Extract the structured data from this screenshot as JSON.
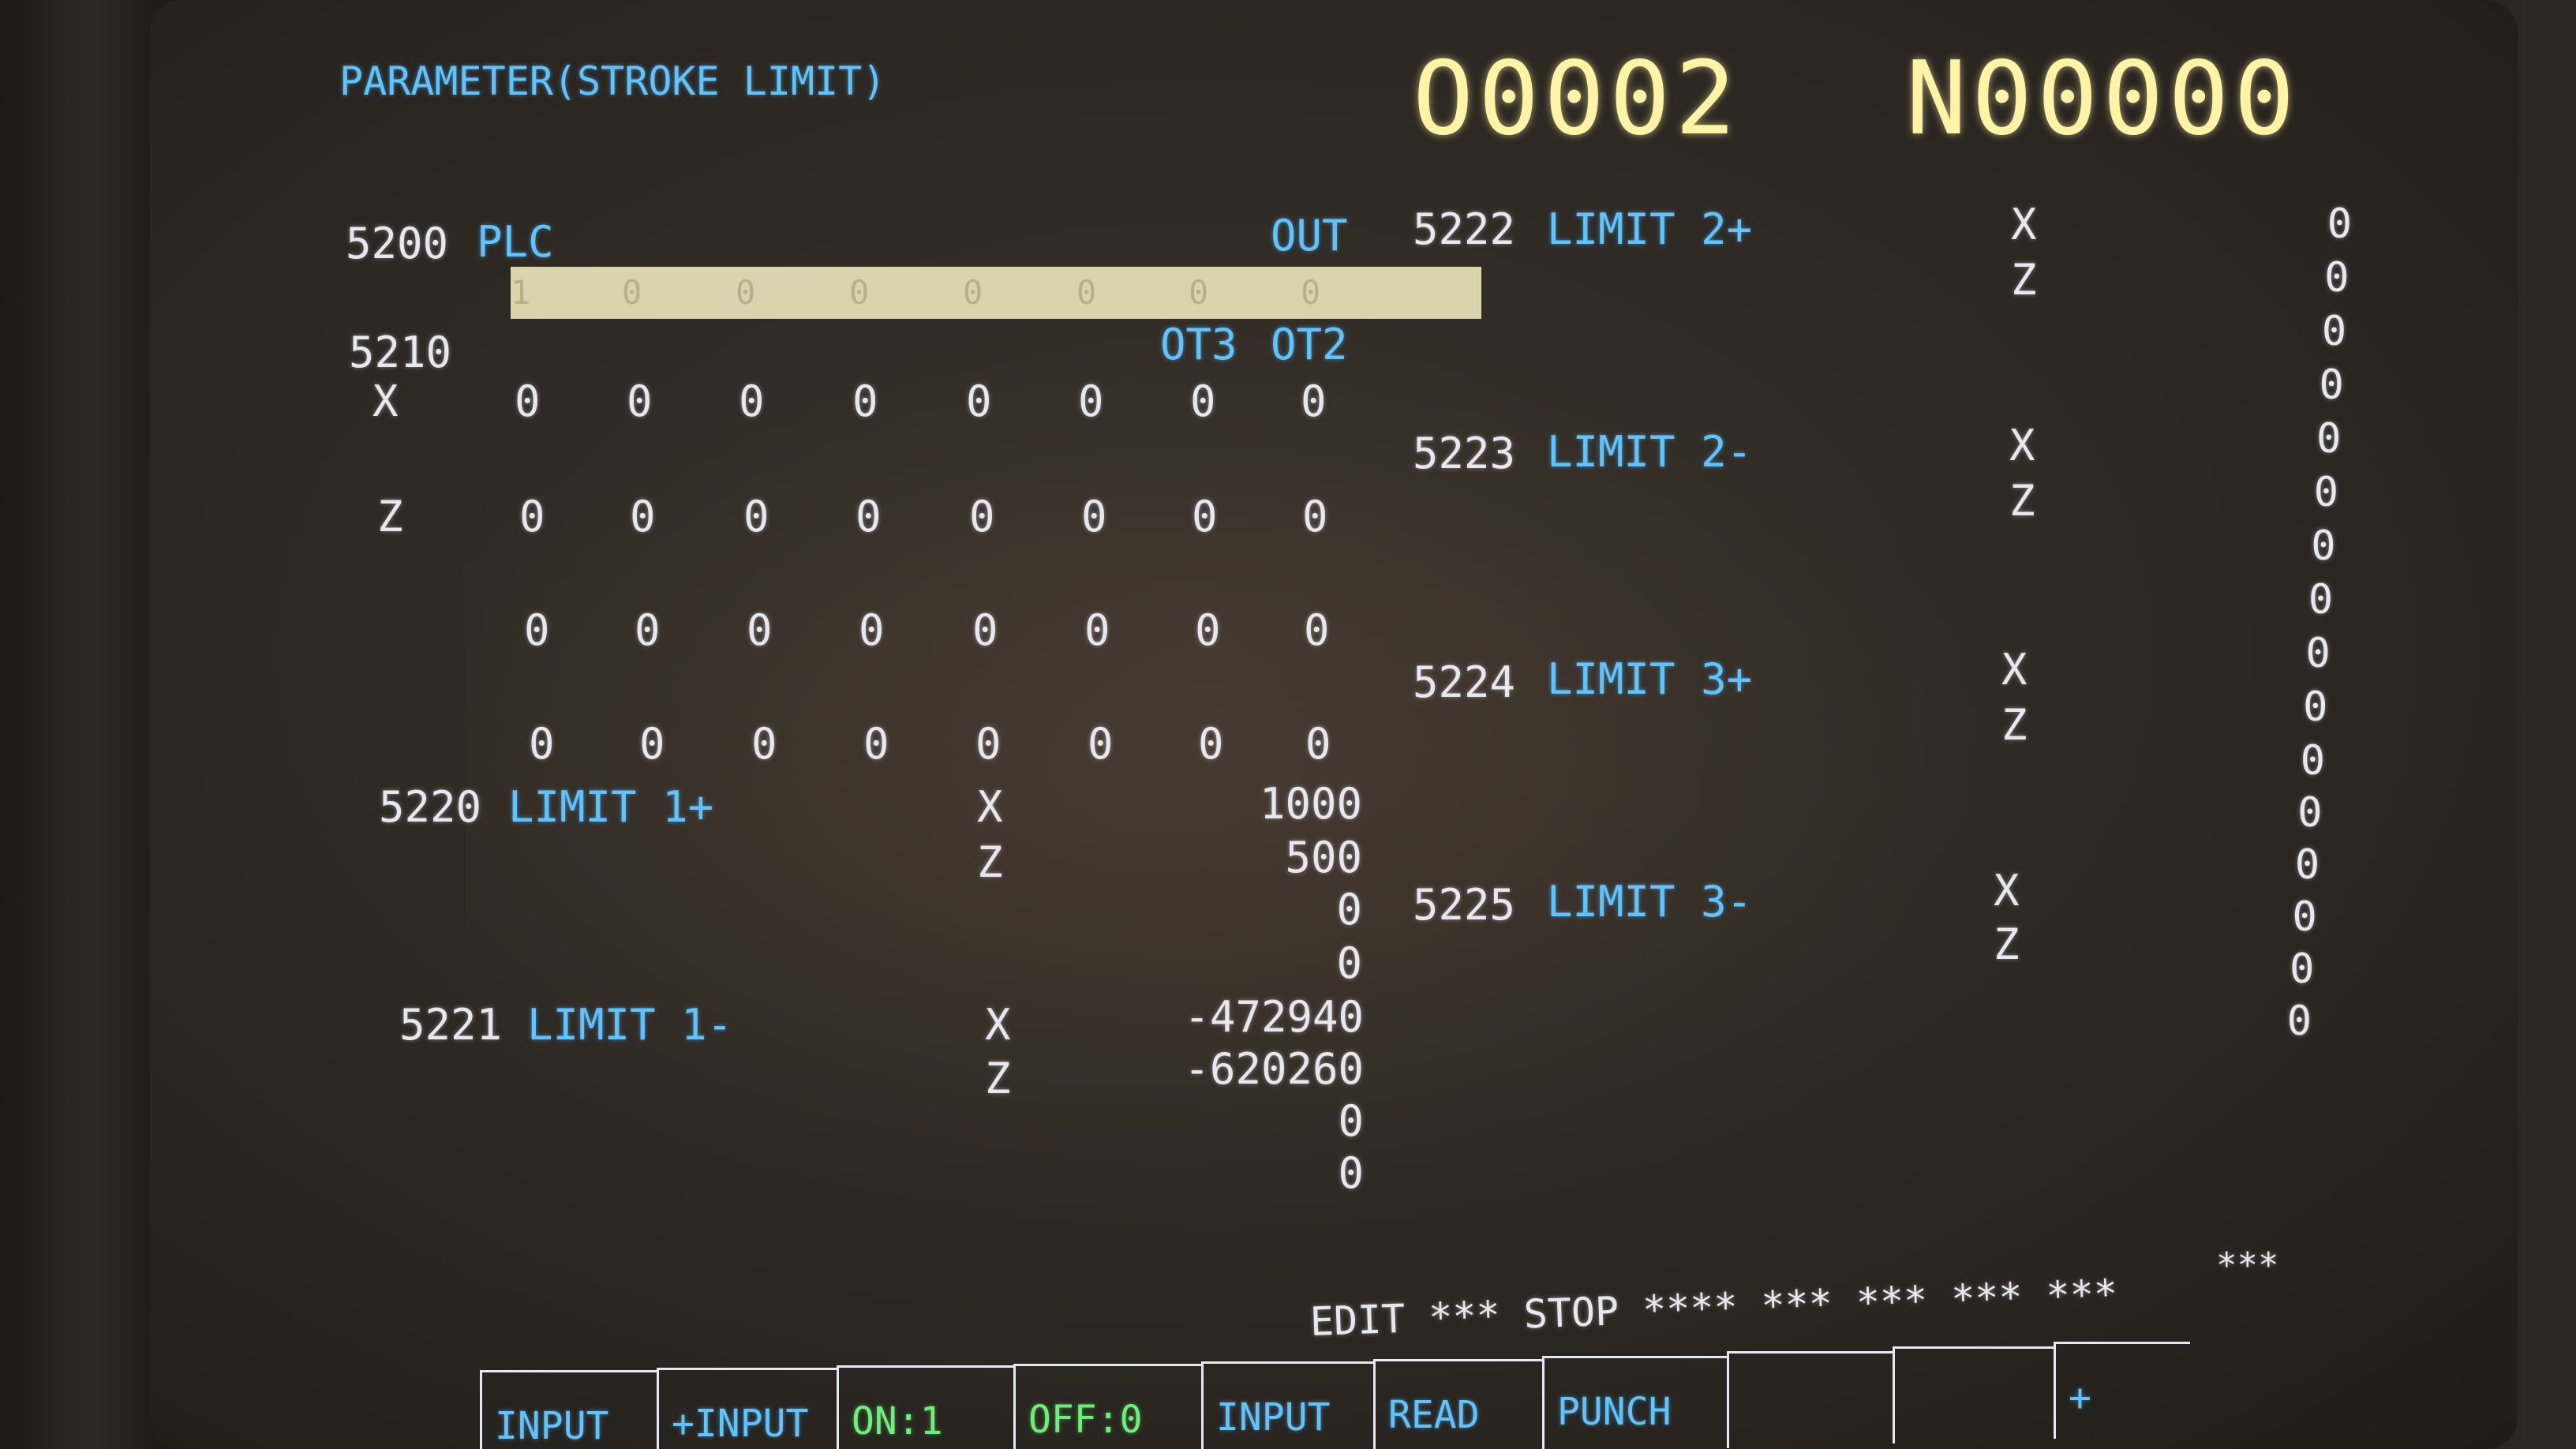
{
  "header": {
    "title": "PARAMETER(STROKE LIMIT)",
    "program_number": "O0002",
    "sequence_number": "N00000"
  },
  "plc": {
    "label": "5200 PLC",
    "out_label": "OUT",
    "bits": [
      "1",
      "0",
      "0",
      "0",
      "0",
      "0",
      "0",
      "0"
    ]
  },
  "p5210": {
    "label": "5210",
    "ot3_label": "OT3",
    "ot2_label": "OT2",
    "rows": [
      {
        "axis": "X",
        "bits": [
          "0",
          "0",
          "0",
          "0",
          "0",
          "0",
          "0",
          "0"
        ]
      },
      {
        "axis": "Z",
        "bits": [
          "0",
          "0",
          "0",
          "0",
          "0",
          "0",
          "0",
          "0"
        ]
      },
      {
        "axis": "",
        "bits": [
          "0",
          "0",
          "0",
          "0",
          "0",
          "0",
          "0",
          "0"
        ]
      },
      {
        "axis": "",
        "bits": [
          "0",
          "0",
          "0",
          "0",
          "0",
          "0",
          "0",
          "0"
        ]
      }
    ]
  },
  "limit_1_plus": {
    "number": "5220",
    "name": "LIMIT 1+",
    "axes": [
      "X",
      "Z"
    ],
    "values": [
      "1000",
      "500",
      "0",
      "0"
    ]
  },
  "limit_1_minus": {
    "number": "5221",
    "name": "LIMIT 1-",
    "axes": [
      "X",
      "Z"
    ],
    "values": [
      "-472940",
      "-620260",
      "0",
      "0"
    ]
  },
  "limit_2_plus": {
    "number": "5222",
    "name": "LIMIT 2+",
    "axes": [
      "X",
      "Z"
    ]
  },
  "limit_2_minus": {
    "number": "5223",
    "name": "LIMIT 2-",
    "axes": [
      "X",
      "Z"
    ]
  },
  "limit_3_plus": {
    "number": "5224",
    "name": "LIMIT 3+",
    "axes": [
      "X",
      "Z"
    ]
  },
  "limit_3_minus": {
    "number": "5225",
    "name": "LIMIT 3-",
    "axes": [
      "X",
      "Z"
    ]
  },
  "right_values": [
    "0",
    "0",
    "0",
    "0",
    "0",
    "0",
    "0",
    "0",
    "0",
    "0",
    "0",
    "0",
    "0",
    "0",
    "0",
    "0"
  ],
  "status": {
    "mode": "EDIT",
    "stars1": "***",
    "state": "STOP",
    "stars2": "****",
    "stars3": "***",
    "stars4": "***",
    "stars5": "***",
    "stars6": "***",
    "stars7": "***"
  },
  "softkeys": [
    {
      "label": "INPUT",
      "color": "cyan"
    },
    {
      "label": "+INPUT",
      "color": "cyan"
    },
    {
      "label": "ON:1",
      "color": "green"
    },
    {
      "label": "OFF:0",
      "color": "green"
    },
    {
      "label": "INPUT",
      "color": "cyan"
    },
    {
      "label": "READ",
      "color": "cyan"
    },
    {
      "label": "PUNCH",
      "color": "cyan"
    },
    {
      "label": "",
      "color": "cyan"
    },
    {
      "label": "",
      "color": "cyan"
    },
    {
      "label": "+",
      "color": "cyan"
    }
  ]
}
